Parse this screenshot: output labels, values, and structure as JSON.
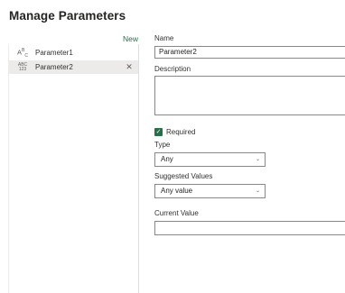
{
  "dialog": {
    "title": "Manage Parameters"
  },
  "parameters_list": {
    "new_label": "New",
    "items": [
      {
        "label": "Parameter1",
        "type_icon": "text-type-icon",
        "icon_text": "Aᴮᴄ"
      },
      {
        "label": "Parameter2",
        "type_icon": "number-type-icon",
        "icon_top": "ABC",
        "icon_bottom": "123",
        "selected": true
      }
    ]
  },
  "form": {
    "name_label": "Name",
    "name_value": "Parameter2",
    "description_label": "Description",
    "description_value": "",
    "required_label": "Required",
    "required_checked": true,
    "type_label": "Type",
    "type_value": "Any",
    "suggested_label": "Suggested Values",
    "suggested_value": "Any value",
    "current_label": "Current Value",
    "current_value": ""
  },
  "colors": {
    "accent": "#217346",
    "selected_bg": "#edebe9",
    "border": "#8a8886"
  }
}
